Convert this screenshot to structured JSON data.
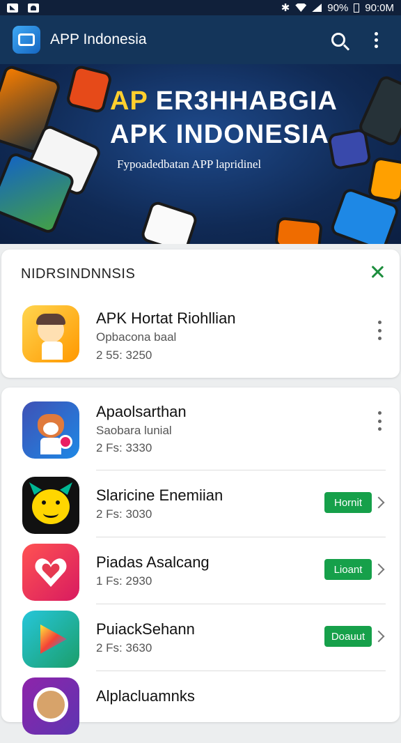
{
  "status": {
    "battery": "90%",
    "time": "90:0M"
  },
  "appbar": {
    "title": "APP Indonesia"
  },
  "banner": {
    "title_line1_prefix": "AP",
    "title_line1_rest": " ER3HHABGIA",
    "title_line2": "APK INDONESIA",
    "subtitle": "Fypoadedbatan APP lapridinel"
  },
  "section1": {
    "title": "NIDRSINDNNSIS",
    "item": {
      "name": "APK Hortat Riohllian",
      "sub": "Opbacona baal",
      "meta": "2 55: 3250"
    }
  },
  "list": [
    {
      "name": "Apaolsarthan",
      "sub": "Saobara lunial",
      "meta": "2 Fs: 3330",
      "action": ""
    },
    {
      "name": "Slaricine Enemiian",
      "sub": "",
      "meta": "2 Fs: 3030",
      "action": "Hornit"
    },
    {
      "name": "Piadas Asalcang",
      "sub": "",
      "meta": "1 Fs: 2930",
      "action": "Lioant"
    },
    {
      "name": "PuiackSehann",
      "sub": "",
      "meta": "2 Fs: 3630",
      "action": "Doauut"
    },
    {
      "name": "Alplacluamnks",
      "sub": "",
      "meta": "",
      "action": ""
    }
  ]
}
